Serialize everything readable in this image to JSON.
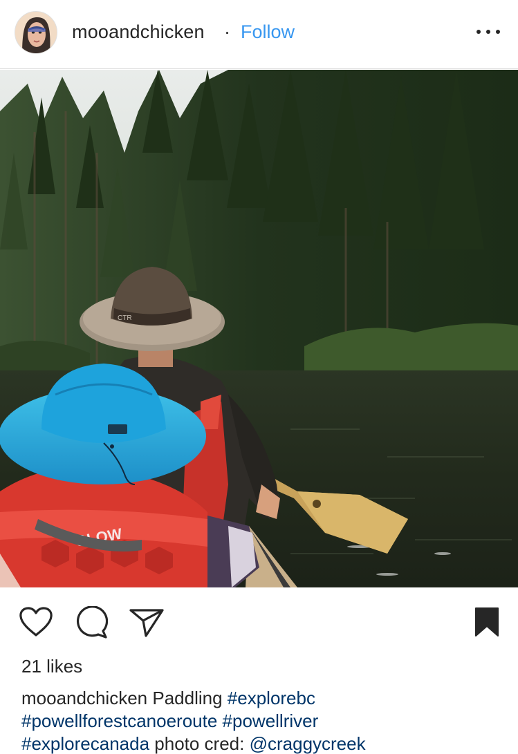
{
  "post": {
    "username": "mooandchicken",
    "separator": "·",
    "follow_label": "Follow",
    "more_icon": "more-options-icon",
    "image_alt": "Two people in a canoe paddling on a forest-lined river, wearing sun hats and life jackets"
  },
  "actions": {
    "like_icon": "heart-icon",
    "comment_icon": "comment-icon",
    "share_icon": "share-icon",
    "save_icon": "bookmark-icon"
  },
  "likes": "21 likes",
  "caption": {
    "username": "mooandchicken",
    "text_1": " Paddling ",
    "tag_1": "#explorebc",
    "tag_2": "#powellforestcanoeroute",
    "space_1": " ",
    "tag_3": "#powellriver",
    "tag_4": "#explorecanada",
    "text_2": " photo cred: ",
    "mention": "@craggycreek"
  },
  "colors": {
    "link_blue": "#3897f0",
    "hashtag_navy": "#003569",
    "text": "#262626",
    "divider": "#dbdbdb"
  }
}
